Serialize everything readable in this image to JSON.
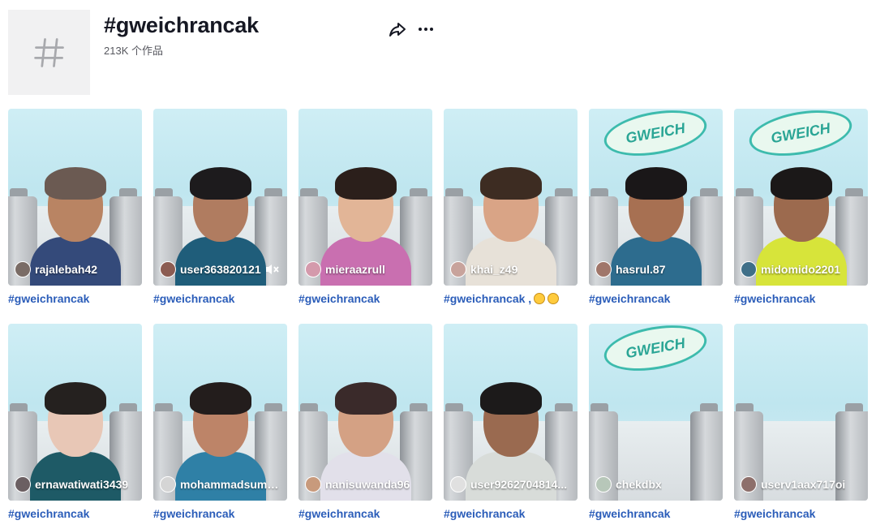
{
  "header": {
    "title": "#gweichrancak",
    "count": "213K 个作品",
    "icons": {
      "tag": "hashtag-icon",
      "share": "share-icon",
      "more": "more-icon"
    }
  },
  "videos": [
    {
      "username": "rajalebah42",
      "caption": "#gweichrancak",
      "skin": "#b98463",
      "hair": "#6b5a52",
      "shirt": "#344a7a",
      "avatar": "#7a6c66",
      "banner": false,
      "muted": false
    },
    {
      "username": "user363820121",
      "caption": "#gweichrancak",
      "skin": "#b07c60",
      "hair": "#1d1b1d",
      "shirt": "#1f5d7a",
      "avatar": "#8c5c52",
      "banner": false,
      "muted": true
    },
    {
      "username": "mieraazrull",
      "caption": "#gweichrancak",
      "skin": "#e2b597",
      "hair": "#2b1f1b",
      "shirt": "#c96fb0",
      "avatar": "#d49aac",
      "banner": false,
      "muted": false
    },
    {
      "username": "khai_z49",
      "caption": "#gweichrancak",
      "caption_emojis": 2,
      "skin": "#d9a486",
      "hair": "#3d2c22",
      "shirt": "#e7e1d8",
      "avatar": "#c8a39c",
      "banner": false,
      "muted": false
    },
    {
      "username": "hasrul.87",
      "caption": "#gweichrancak",
      "skin": "#a77052",
      "hair": "#1a1718",
      "shirt": "#2d6c8e",
      "avatar": "#a0766a",
      "banner": true,
      "muted": false
    },
    {
      "username": "midomido2201",
      "caption": "#gweichrancak",
      "skin": "#9c6a4e",
      "hair": "#1b1818",
      "shirt": "#d7e43a",
      "avatar": "#3f6f88",
      "banner": true,
      "muted": false
    },
    {
      "username": "ernawatiwati3439",
      "caption": "#gweichrancak",
      "skin": "#e8c7b6",
      "hair": "#25211f",
      "shirt": "#1e5a66",
      "avatar": "#6b5f62",
      "banner": false,
      "muted": false
    },
    {
      "username": "mohammadsumo...",
      "caption": "#gweichrancak",
      "skin": "#bd8468",
      "hair": "#231d1c",
      "shirt": "#2f80a6",
      "avatar": "#d5d5d5",
      "banner": false,
      "muted": false
    },
    {
      "username": "nanisuwanda96",
      "caption": "#gweichrancak",
      "skin": "#d4a184",
      "hair": "#3a2a2a",
      "shirt": "#e2e0ea",
      "avatar": "#c89a7c",
      "banner": false,
      "muted": false
    },
    {
      "username": "user9262704814...",
      "caption": "#gweichrancak",
      "skin": "#9a6a50",
      "hair": "#1c1a1a",
      "shirt": "#d8dcd9",
      "avatar": "#e0e0e0",
      "banner": false,
      "muted": false
    },
    {
      "username": "chekdbx",
      "caption": "#gweichrancak",
      "skin": "#e7eef0",
      "hair": "#e7eef0",
      "shirt": "#e7eef0",
      "avatar": "#b7c7b9",
      "banner": true,
      "empty": true,
      "muted": false
    },
    {
      "username": "userv1aax717oi",
      "caption": "#gweichrancak",
      "skin": "#e7eef0",
      "hair": "#e7eef0",
      "shirt": "#e7eef0",
      "avatar": "#8d6f6b",
      "banner": false,
      "empty": true,
      "muted": false
    }
  ],
  "banner_text": "GWEICH"
}
